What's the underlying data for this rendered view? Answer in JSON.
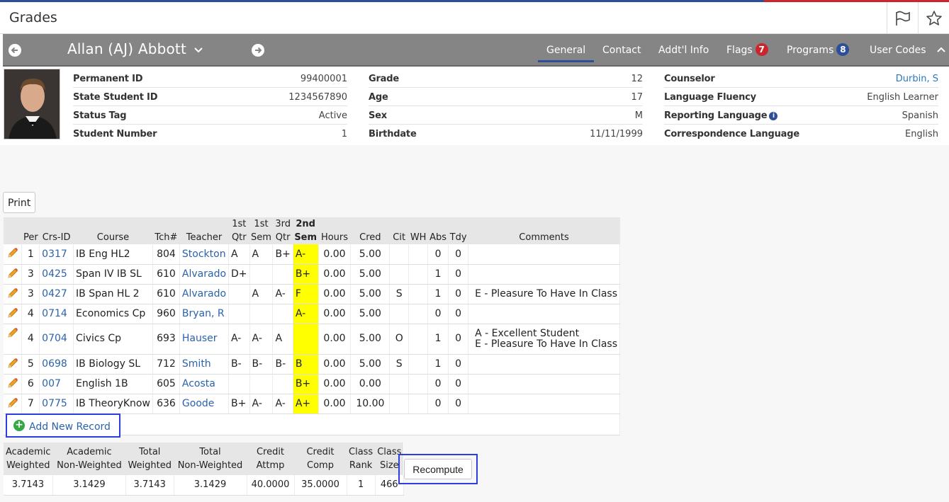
{
  "header": {
    "title": "Grades"
  },
  "student": {
    "name": "Allan (AJ) Abbott",
    "tabs": [
      {
        "label": "General",
        "active": true
      },
      {
        "label": "Contact"
      },
      {
        "label": "Addt'l Info"
      },
      {
        "label": "Flags",
        "badge": "7"
      },
      {
        "label": "Programs",
        "badge": "8"
      },
      {
        "label": "User Codes"
      }
    ]
  },
  "info": {
    "col1": [
      {
        "label": "Permanent ID",
        "value": "99400001"
      },
      {
        "label": "State Student ID",
        "value": "1234567890"
      },
      {
        "label": "Status Tag",
        "value": "Active"
      },
      {
        "label": "Student Number",
        "value": "1"
      }
    ],
    "col2": [
      {
        "label": "Grade",
        "value": "12"
      },
      {
        "label": "Age",
        "value": "17"
      },
      {
        "label": "Sex",
        "value": "M"
      },
      {
        "label": "Birthdate",
        "value": "11/11/1999"
      }
    ],
    "col3": [
      {
        "label": "Counselor",
        "value": "Durbin, S"
      },
      {
        "label": "Language Fluency",
        "value": "English Learner"
      },
      {
        "label": "Reporting Language",
        "value": "Spanish"
      },
      {
        "label": "Correspondence Language",
        "value": "English"
      }
    ]
  },
  "actions": {
    "print": "Print",
    "add_new": "Add New Record",
    "recompute": "Recompute"
  },
  "grades": {
    "headers": {
      "per": "Per",
      "crs": "Crs-ID",
      "course": "Course",
      "tch": "Tch#",
      "teacher": "Teacher",
      "q1a": "1st",
      "q1b": "Qtr",
      "s1a": "1st",
      "s1b": "Sem",
      "q3a": "3rd",
      "q3b": "Qtr",
      "s2a": "2nd",
      "s2b": "Sem",
      "hours": "Hours",
      "cred": "Cred",
      "cit": "Cit",
      "wh": "WH",
      "abs": "Abs",
      "tdy": "Tdy",
      "comments": "Comments"
    },
    "rows": [
      {
        "per": "1",
        "crs": "0317",
        "course": "IB Eng HL2",
        "tch": "804",
        "teacher": "Stockton",
        "q1": "A",
        "s1": "A",
        "q3": "B+",
        "s2": "A-",
        "hours": "0.00",
        "cred": "5.00",
        "cit": "",
        "wh": "",
        "abs": "0",
        "tdy": "0",
        "c1": "",
        "c2": ""
      },
      {
        "per": "3",
        "crs": "0425",
        "course": "Span IV IB SL",
        "tch": "610",
        "teacher": "Alvarado",
        "q1": "D+",
        "s1": "",
        "q3": "",
        "s2": "B+",
        "hours": "0.00",
        "cred": "5.00",
        "cit": "",
        "wh": "",
        "abs": "1",
        "tdy": "0",
        "c1": "",
        "c2": ""
      },
      {
        "per": "3",
        "crs": "0427",
        "course": "IB Span HL 2",
        "tch": "610",
        "teacher": "Alvarado",
        "q1": "",
        "s1": "A",
        "q3": "A-",
        "s2": "F",
        "hours": "0.00",
        "cred": "5.00",
        "cit": "S",
        "wh": "",
        "abs": "1",
        "tdy": "0",
        "c1": "E - Pleasure To Have In Class",
        "c2": ""
      },
      {
        "per": "4",
        "crs": "0714",
        "course": "Economics Cp",
        "tch": "960",
        "teacher": "Bryan, R",
        "q1": "",
        "s1": "",
        "q3": "",
        "s2": "A-",
        "hours": "0.00",
        "cred": "5.00",
        "cit": "",
        "wh": "",
        "abs": "0",
        "tdy": "0",
        "c1": "",
        "c2": ""
      },
      {
        "per": "4",
        "crs": "0704",
        "course": "Civics Cp",
        "tch": "693",
        "teacher": "Hauser",
        "q1": "A-",
        "s1": "A-",
        "q3": "A",
        "s2": "",
        "hours": "0.00",
        "cred": "5.00",
        "cit": "O",
        "wh": "",
        "abs": "1",
        "tdy": "0",
        "c1": "A - Excellent Student",
        "c2": "E - Pleasure To Have In Class"
      },
      {
        "per": "5",
        "crs": "0698",
        "course": "IB Biology SL",
        "tch": "712",
        "teacher": "Smith",
        "q1": "B-",
        "s1": "B-",
        "q3": "B-",
        "s2": "B",
        "hours": "0.00",
        "cred": "5.00",
        "cit": "S",
        "wh": "",
        "abs": "1",
        "tdy": "0",
        "c1": "",
        "c2": ""
      },
      {
        "per": "6",
        "crs": "007",
        "course": "English 1B",
        "tch": "605",
        "teacher": "Acosta",
        "q1": "",
        "s1": "",
        "q3": "",
        "s2": "B+",
        "hours": "0.00",
        "cred": "0.00",
        "cit": "",
        "wh": "",
        "abs": "0",
        "tdy": "0",
        "c1": "",
        "c2": ""
      },
      {
        "per": "7",
        "crs": "0775",
        "course": "IB TheoryKnow",
        "tch": "636",
        "teacher": "Goode",
        "q1": "B+",
        "s1": "A-",
        "q3": "A-",
        "s2": "A+",
        "hours": "0.00",
        "cred": "10.00",
        "cit": "",
        "wh": "",
        "abs": "0",
        "tdy": "0",
        "c1": "",
        "c2": ""
      }
    ]
  },
  "gpa": {
    "headers": [
      [
        "Academic",
        "Weighted"
      ],
      [
        "Academic",
        "Non-Weighted"
      ],
      [
        "Total",
        "Weighted"
      ],
      [
        "Total",
        "Non-Weighted"
      ],
      [
        "Credit",
        "Attmp"
      ],
      [
        "Credit",
        "Comp"
      ],
      [
        "Class",
        "Rank"
      ],
      [
        "Class",
        "Size"
      ]
    ],
    "values": [
      "3.7143",
      "3.1429",
      "3.7143",
      "3.1429",
      "40.0000",
      "35.0000",
      "1",
      "466"
    ]
  }
}
